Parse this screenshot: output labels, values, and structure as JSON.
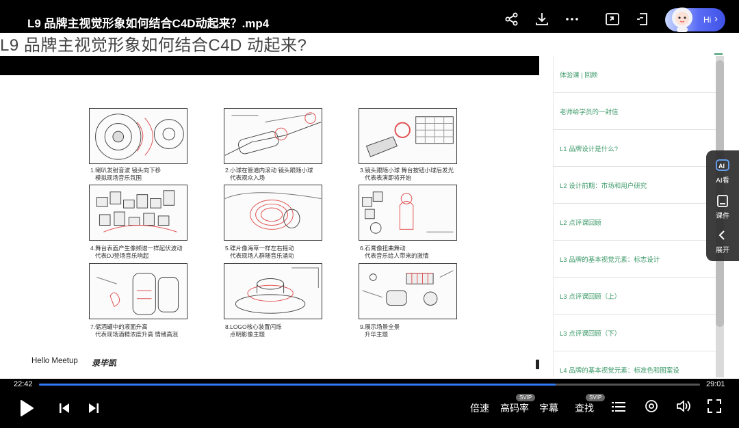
{
  "header": {
    "title": "L9 品牌主视觉形象如何结合C4D动起来？.mp4",
    "assistant_label": "Hi",
    "icons": [
      "share-icon",
      "download-icon",
      "more-icon",
      "screen-cast-icon",
      "pip-icon"
    ]
  },
  "slide": {
    "title": "L9 品牌主视觉形象如何结合C4D 动起来?",
    "captions": [
      [
        "1.喇叭发射音波 镜头向下移",
        "模拟现场音乐氛围"
      ],
      [
        "2.小球在管道内滚动 镜头跟随小球",
        "代表观众入场"
      ],
      [
        "3.镜头跟随小球 舞台按钮小球后发光",
        "代表表演即将开始"
      ],
      [
        "4.舞台表面产生像频谱一样起伏波动",
        "代表DJ登场音乐响起"
      ],
      [
        "5.碟片像海草一样左右摇动",
        "代表现场人群随音乐涌动"
      ],
      [
        "6.石膏像扭曲舞动",
        "代表音乐给人带来的激情"
      ],
      [
        "7.储酒罐中的液面升高",
        "代表现场酒精浓度升高 情绪高涨"
      ],
      [
        "8.LOGO核心装置闪烁",
        "点明影像主题"
      ],
      [
        "9.展示场景全景",
        "升华主题"
      ]
    ],
    "footer_left": "Hello Meetup",
    "footer_brand": "录毕凯"
  },
  "lessons": [
    "体验课 | 回顾",
    "老师给学员的一封信",
    "L1 品牌设计是什么?",
    "L2 设计前期：市场和用户研究",
    "L2 点评课回顾",
    "L3 品牌的基本视觉元素：标志设计",
    "L3 点评课回顾（上）",
    "L3 点评课回顾（下）",
    "L4 品牌的基本视觉元素：标准色和图案设"
  ],
  "side_menu": {
    "ai_label": "AI看",
    "courseware_label": "课件",
    "expand_label": "展开"
  },
  "player": {
    "current_time": "22:42",
    "total_time": "29:01",
    "progress": 0.782,
    "speed_label": "倍速",
    "quality_label": "高码率",
    "quality_badge": "SVIP",
    "subtitle_label": "字幕",
    "search_label": "查找",
    "search_badge": "SVIP",
    "accent_color": "#2f7bf6"
  }
}
